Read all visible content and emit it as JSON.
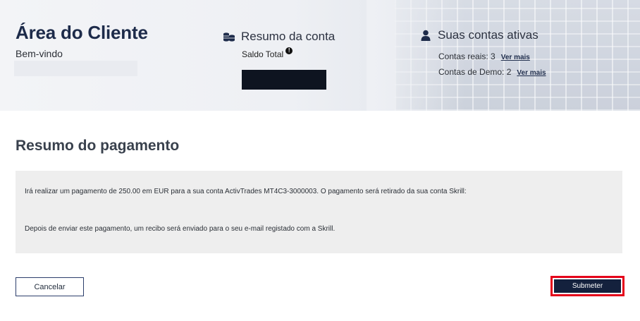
{
  "header": {
    "title": "Área do Cliente",
    "welcome": "Bem-vindo",
    "account_summary": {
      "icon": "coins-icon",
      "title": "Resumo da conta",
      "total_balance_label": "Saldo Total",
      "info_icon_glyph": "!"
    },
    "active_accounts": {
      "icon": "user-icon",
      "title": "Suas contas ativas",
      "real_accounts": "Contas reais: 3",
      "demo_accounts": "Contas de Demo: 2",
      "see_more": "Ver mais"
    }
  },
  "main": {
    "title": "Resumo do pagamento",
    "message_1": "Irá realizar um pagamento de 250.00 em EUR para a sua conta ActivTrades MT4C3-3000003. O pagamento será retirado da sua conta Skrill:",
    "message_2": "Depois de enviar este pagamento, um recibo será enviado para o seu e-mail registado com a Skrill."
  },
  "actions": {
    "cancel_label": "Cancelar",
    "submit_label": "Submeter",
    "highlight_color": "#e5001a",
    "primary_color": "#14213d"
  }
}
